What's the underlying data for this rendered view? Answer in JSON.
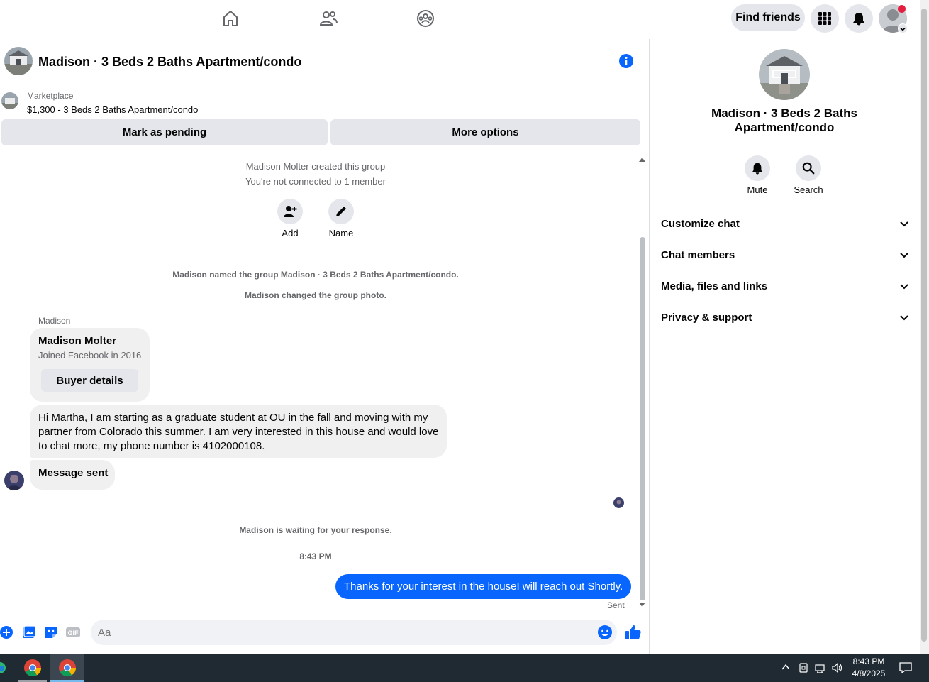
{
  "topbar": {
    "find_friends_label": "Find friends"
  },
  "chat": {
    "title": "Madison · 3 Beds 2 Baths Apartment/condo"
  },
  "marketplace": {
    "label": "Marketplace",
    "item": "$1,300 - 3 Beds 2 Baths Apartment/condo",
    "mark_pending_label": "Mark as pending",
    "more_options_label": "More options"
  },
  "thread": {
    "created_text": "Madison Molter created this group",
    "not_connected_text": "You're not connected to 1 member",
    "add_label": "Add",
    "name_label": "Name",
    "named_group_text": "Madison named the group Madison · 3 Beds 2 Baths Apartment/condo.",
    "changed_photo_text": "Madison changed the group photo.",
    "sender_name": "Madison",
    "card": {
      "name": "Madison Molter",
      "joined": "Joined Facebook in 2016",
      "buyer_details_label": "Buyer details"
    },
    "message_text": "Hi Martha, I am starting as a graduate student at OU in the fall and moving with my partner from Colorado this summer. I am very interested in this house and would love to chat more, my phone number is 4102000108.",
    "message_sent_text": "Message sent",
    "waiting_text": "Madison is waiting for your response.",
    "timestamp": "8:43 PM",
    "my_message": "Thanks for your interest in the houseI will reach out Shortly.",
    "sent_status": "Sent"
  },
  "composer": {
    "placeholder": "Aa"
  },
  "right_panel": {
    "title": "Madison · 3 Beds 2 Baths Apartment/condo",
    "mute_label": "Mute",
    "search_label": "Search",
    "sections": [
      {
        "label": "Customize chat"
      },
      {
        "label": "Chat members"
      },
      {
        "label": "Media, files and links"
      },
      {
        "label": "Privacy & support"
      }
    ]
  },
  "taskbar": {
    "time": "8:43 PM",
    "date": "4/8/2025"
  },
  "colors": {
    "accent": "#0866ff",
    "bubble_gray": "#f0f0f0",
    "button_gray": "#e4e6eb",
    "taskbar": "#1f2a33"
  }
}
